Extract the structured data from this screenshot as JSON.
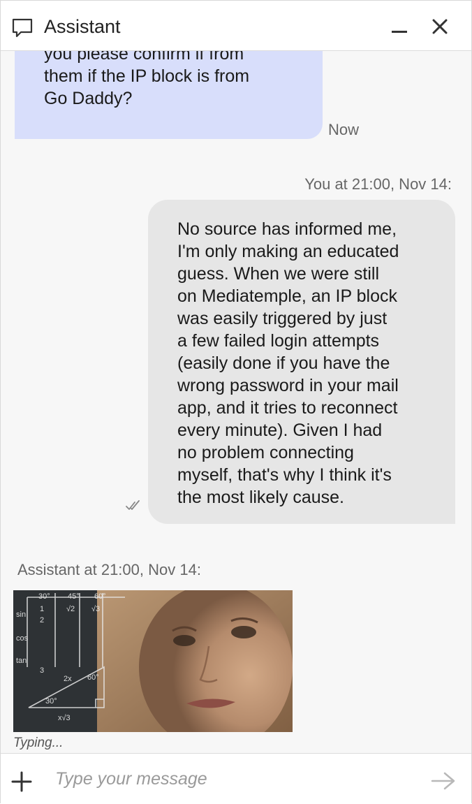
{
  "header": {
    "title": "Assistant",
    "icons": {
      "chat": "chat-bubble-icon",
      "minimize": "minimize-icon",
      "close": "close-icon"
    }
  },
  "messages": {
    "assistant_partial": {
      "lines": [
        "you please confirm if from",
        "them if the IP block is from",
        "Go Daddy?"
      ],
      "status": "Now"
    },
    "user_message": {
      "meta": "You at 21:00, Nov 14:",
      "lines": [
        "No source has informed me,",
        "I'm only making an educated",
        "guess. When we were still",
        "on Mediatemple, an IP block",
        "was easily triggered by just",
        "a few failed login attempts",
        "(easily done if you have the",
        "wrong password in your mail",
        "app, and it tries to reconnect",
        "every minute). Given I had",
        "no problem connecting",
        "myself, that's why I think it's",
        "the most likely cause."
      ],
      "receipt_icon": "double-check-icon"
    },
    "assistant_image": {
      "meta": "Assistant at 21:00, Nov 14:",
      "math_labels": [
        "sin",
        "cos",
        "tan",
        "30°",
        "45°",
        "60°",
        "1",
        "2",
        "√2",
        "√3",
        "2x",
        "60°",
        "30°",
        "x√3",
        "3"
      ]
    },
    "typing_indicator": "Typing..."
  },
  "composer": {
    "placeholder": "Type your message",
    "value": "",
    "icons": {
      "add": "plus-icon",
      "send": "send-arrow-icon"
    }
  },
  "colors": {
    "assistant_bubble": "#d8defb",
    "user_bubble": "#e6e6e6",
    "background": "#f7f7f7",
    "meta_text": "#666666"
  }
}
